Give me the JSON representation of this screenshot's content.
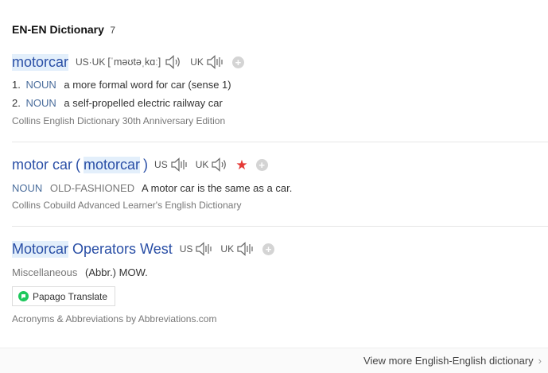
{
  "header": {
    "title": "EN-EN Dictionary",
    "count": "7"
  },
  "entries": [
    {
      "headword": "motorcar",
      "pron_us_uk_label": "US·UK",
      "pron_ipa": "[ˈməʊtəˌkɑː]",
      "pron_uk_label": "UK",
      "senses": [
        {
          "num": "1.",
          "pos": "NOUN",
          "def": "a more formal word for car (sense 1)"
        },
        {
          "num": "2.",
          "pos": "NOUN",
          "def": "a self-propelled electric railway car"
        }
      ],
      "source": "Collins English Dictionary 30th Anniversary Edition"
    },
    {
      "headword_pre": "motor car",
      "paren_open": "(",
      "headword_hl": "motorcar",
      "paren_close": ")",
      "us_label": "US",
      "uk_label": "UK",
      "star": "★",
      "pos": "NOUN",
      "register": "OLD-FASHIONED",
      "def": "A motor car is the same as a car.",
      "source": "Collins Cobuild Advanced Learner's English Dictionary"
    },
    {
      "headword_hl": "Motorcar",
      "headword_rest": "Operators West",
      "us_label": "US",
      "uk_label": "UK",
      "category": "Miscellaneous",
      "def": "(Abbr.) MOW.",
      "papago_label": "Papago Translate",
      "source": "Acronyms & Abbreviations by Abbreviations.com"
    }
  ],
  "add_symbol": "+",
  "more_link": {
    "label": "View more English-English dictionary",
    "chevron": "›"
  },
  "icons": [
    "speaker-icon",
    "plus-icon",
    "star-icon",
    "papago-icon",
    "chevron-right-icon"
  ],
  "colors": {
    "headword": "#2a4fa6",
    "highlight": "#e3effb",
    "pos": "#4a6d9c",
    "star": "#e53935",
    "papago": "#1ec85d"
  }
}
